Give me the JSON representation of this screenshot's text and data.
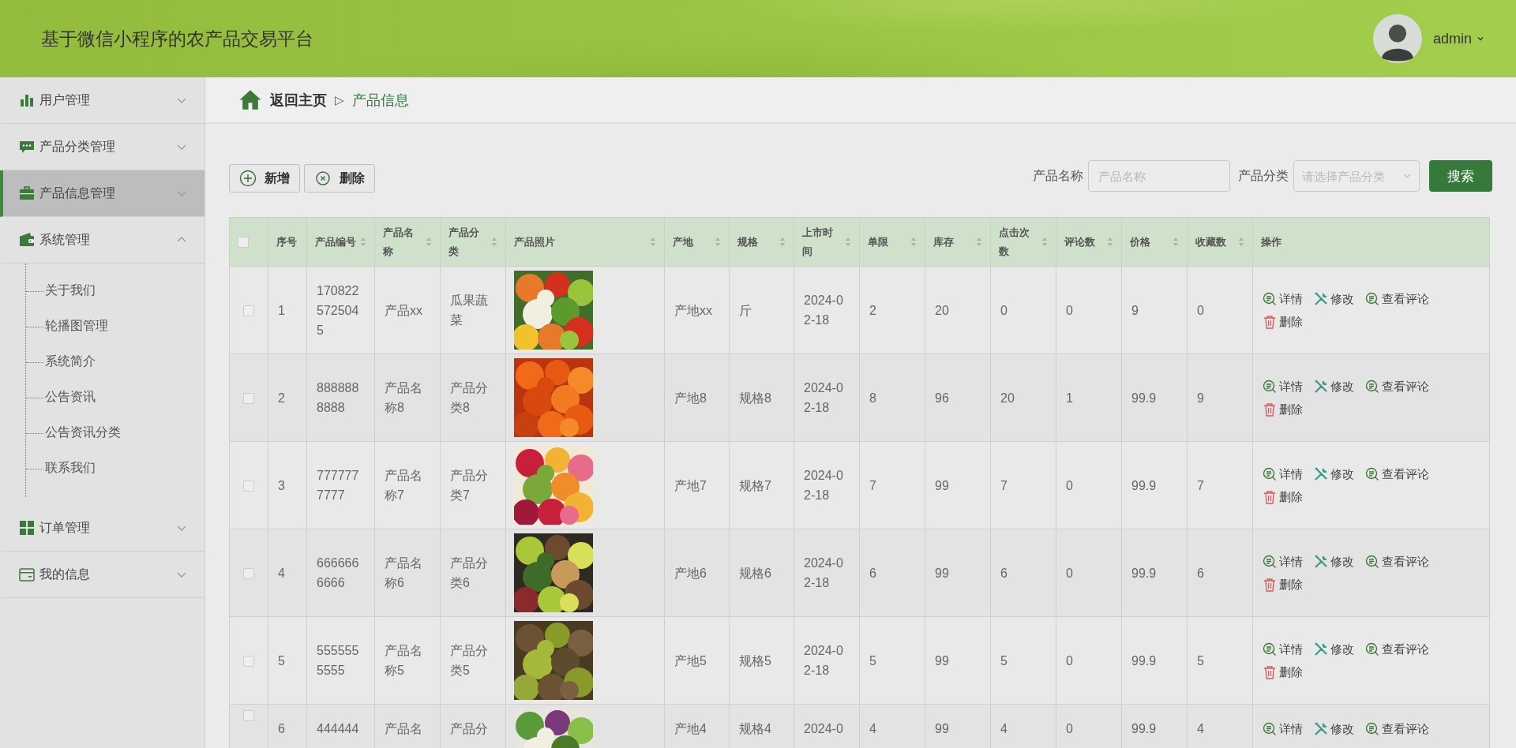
{
  "header": {
    "title": "基于微信小程序的农产品交易平台",
    "user": "admin"
  },
  "sidebar": {
    "items": [
      {
        "label": "用户管理",
        "kind": "bars",
        "selected": false,
        "expanded": false
      },
      {
        "label": "产品分类管理",
        "kind": "chat",
        "selected": false,
        "expanded": false
      },
      {
        "label": "产品信息管理",
        "kind": "briefcase",
        "selected": true,
        "expanded": false
      },
      {
        "label": "系统管理",
        "kind": "wallet",
        "selected": false,
        "expanded": true,
        "children": [
          {
            "label": "关于我们"
          },
          {
            "label": "轮播图管理"
          },
          {
            "label": "系统简介"
          },
          {
            "label": "公告资讯"
          },
          {
            "label": "公告资讯分类"
          },
          {
            "label": "联系我们"
          }
        ]
      },
      {
        "label": "订单管理",
        "kind": "grid",
        "selected": false,
        "expanded": false
      },
      {
        "label": "我的信息",
        "kind": "card",
        "selected": false,
        "expanded": false
      }
    ]
  },
  "breadcrumb": {
    "home": "返回主页",
    "separator": "▷",
    "current": "产品信息"
  },
  "toolbar": {
    "buttons": [
      {
        "label": "新增",
        "kind": "add"
      },
      {
        "label": "删除",
        "kind": "remove"
      }
    ]
  },
  "search": {
    "fields": [
      {
        "label": "产品名称",
        "placeholder": "产品名称",
        "kind": "text"
      },
      {
        "label": "产品分类",
        "placeholder": "请选择产品分类",
        "kind": "select"
      }
    ],
    "button": "搜索"
  },
  "table": {
    "header_checked": false,
    "columns": [
      {
        "label": "序号",
        "kind": "text",
        "sortable": false
      },
      {
        "label": "产品编号",
        "kind": "text",
        "sortable": true
      },
      {
        "label": "产品名称",
        "kind": "text",
        "sortable": true
      },
      {
        "label": "产品分类",
        "kind": "text",
        "sortable": true
      },
      {
        "label": "产品照片",
        "sortable": true
      },
      {
        "label": "产地",
        "kind": "text",
        "sortable": true
      },
      {
        "label": "规格",
        "kind": "text",
        "sortable": true
      },
      {
        "label": "上市时间",
        "kind": "text",
        "sortable": true
      },
      {
        "label": "单限",
        "kind": "text",
        "sortable": true
      },
      {
        "label": "库存",
        "kind": "text",
        "sortable": true
      },
      {
        "label": "点击次数",
        "kind": "text",
        "sortable": true
      },
      {
        "label": "评论数",
        "kind": "text",
        "sortable": true
      },
      {
        "label": "价格",
        "kind": "text",
        "sortable": true
      },
      {
        "label": "收藏数",
        "kind": "text",
        "sortable": true
      },
      {
        "label": "操作",
        "kind": "actions",
        "sortable": false
      }
    ],
    "rows": [
      {
        "checked": false,
        "cells": [
          "1",
          "1708225725045",
          "产品xx",
          "瓜果蔬菜",
          {
            "kind": "picture"
          },
          "产地xx",
          "斤",
          "2024-02-18",
          "2",
          "20",
          "0",
          "0",
          "9",
          "0",
          {
            "actions": [
              {
                "label": "详情",
                "kind": "view"
              },
              {
                "label": "修改",
                "kind": "edit"
              },
              {
                "label": "查看评论",
                "kind": "comments"
              },
              {
                "label": "删除",
                "kind": "delete"
              }
            ]
          }
        ]
      },
      {
        "checked": false,
        "cells": [
          "2",
          "8888888888",
          "产品名称8",
          "产品分类8",
          {
            "kind": "picture"
          },
          "产地8",
          "规格8",
          "2024-02-18",
          "8",
          "96",
          "20",
          "1",
          "99.9",
          "9",
          {
            "actions": [
              {
                "label": "详情",
                "kind": "view"
              },
              {
                "label": "修改",
                "kind": "edit"
              },
              {
                "label": "查看评论",
                "kind": "comments"
              },
              {
                "label": "删除",
                "kind": "delete"
              }
            ]
          }
        ]
      },
      {
        "checked": false,
        "cells": [
          "3",
          "7777777777",
          "产品名称7",
          "产品分类7",
          {
            "kind": "picture"
          },
          "产地7",
          "规格7",
          "2024-02-18",
          "7",
          "99",
          "7",
          "0",
          "99.9",
          "7",
          {
            "actions": [
              {
                "label": "详情",
                "kind": "view"
              },
              {
                "label": "修改",
                "kind": "edit"
              },
              {
                "label": "查看评论",
                "kind": "comments"
              },
              {
                "label": "删除",
                "kind": "delete"
              }
            ]
          }
        ]
      },
      {
        "checked": false,
        "cells": [
          "4",
          "6666666666",
          "产品名称6",
          "产品分类6",
          {
            "kind": "picture"
          },
          "产地6",
          "规格6",
          "2024-02-18",
          "6",
          "99",
          "6",
          "0",
          "99.9",
          "6",
          {
            "actions": [
              {
                "label": "详情",
                "kind": "view"
              },
              {
                "label": "修改",
                "kind": "edit"
              },
              {
                "label": "查看评论",
                "kind": "comments"
              },
              {
                "label": "删除",
                "kind": "delete"
              }
            ]
          }
        ]
      },
      {
        "checked": false,
        "cells": [
          "5",
          "5555555555",
          "产品名称5",
          "产品分类5",
          {
            "kind": "picture"
          },
          "产地5",
          "规格5",
          "2024-02-18",
          "5",
          "99",
          "5",
          "0",
          "99.9",
          "5",
          {
            "actions": [
              {
                "label": "详情",
                "kind": "view"
              },
              {
                "label": "修改",
                "kind": "edit"
              },
              {
                "label": "查看评论",
                "kind": "comments"
              },
              {
                "label": "删除",
                "kind": "delete"
              }
            ]
          }
        ]
      },
      {
        "checked": false,
        "cells": [
          "6",
          "444444",
          "产品名",
          "产品分",
          {
            "kind": "picture"
          },
          "产地4",
          "规格4",
          "2024-0",
          "4",
          "99",
          "4",
          "0",
          "99.9",
          "4",
          {
            "actions": [
              {
                "label": "详情",
                "kind": "view"
              },
              {
                "label": "修改",
                "kind": "edit"
              },
              {
                "label": "查看评论",
                "kind": "comments"
              }
            ]
          }
        ]
      }
    ]
  }
}
